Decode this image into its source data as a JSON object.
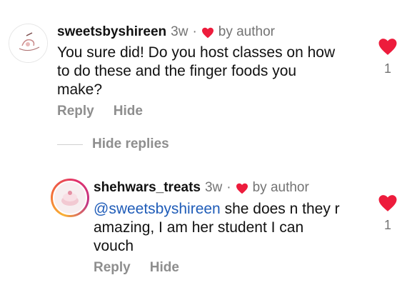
{
  "comments": [
    {
      "username": "sweetsbyshireen",
      "age": "3w",
      "author_badge": "by author",
      "text_lines": [
        "You sure did! Do you host classes on how",
        "to do these and the finger foods you",
        "make?"
      ],
      "reply_label": "Reply",
      "hide_label": "Hide",
      "like_count": "1"
    }
  ],
  "hide_replies_label": "Hide replies",
  "reply": {
    "username": "shehwars_treats",
    "age": "3w",
    "author_badge": "by author",
    "mention": "@sweetsbyshireen",
    "text_line1_rest": " she does n they r",
    "text_lines": [
      "amazing, I am her student I can",
      "vouch"
    ],
    "reply_label": "Reply",
    "hide_label": "Hide",
    "like_count": "1"
  },
  "colors": {
    "heart": "#ed1c3c",
    "mention": "#1f5cb8",
    "muted": "#8e8e8e"
  },
  "icons": {
    "author_heart": "heart-icon",
    "like": "heart-icon",
    "avatar": "avatar-image"
  }
}
